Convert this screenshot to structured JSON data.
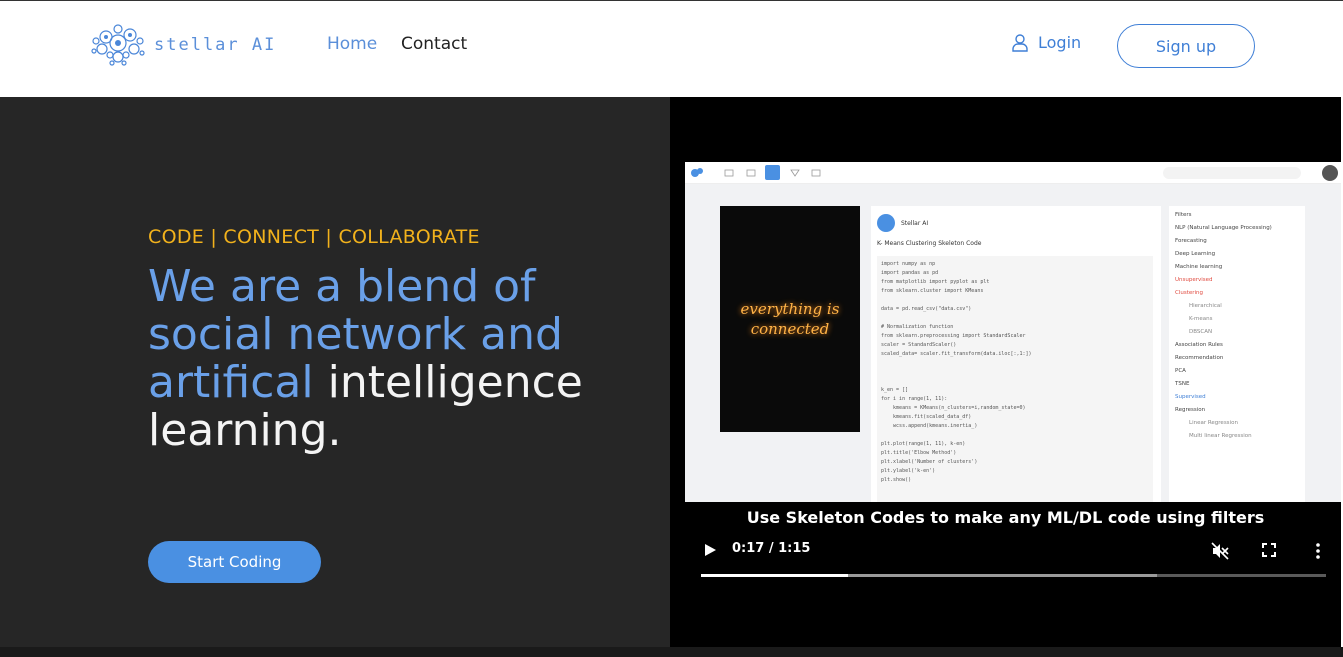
{
  "nav": {
    "brand": "stellar AI",
    "links": [
      "Home",
      "Contact"
    ],
    "login_label": "Login",
    "signup_label": "Sign up"
  },
  "hero": {
    "tagline": "CODE | CONNECT | COLLABORATE",
    "headline_blue": "We are a blend of social network and artifical",
    "headline_white": "intelligence learning.",
    "cta_label": "Start Coding"
  },
  "video": {
    "caption": "Use Skeleton Codes to make any ML/DL code using filters",
    "time": "0:17 / 1:15",
    "played_fraction": 0.235,
    "buffered_fraction": 0.73,
    "preview": {
      "neon_text": "everything is connected",
      "card_name": "Stellar AI",
      "card_title": "K- Means Clustering Skeleton Code",
      "code": "import numpy as np\nimport pandas as pd\nfrom matplotlib import pyplot as plt\nfrom sklearn.cluster import KMeans\n\ndata = pd.read_csv(\"data.csv\")\n\n# Normalization function\nfrom sklearn.preprocessing import StandardScaler\nscaler = StandardScaler()\nscaled_data= scaler.fit_transform(data.iloc[:,1:])\n\n\n\nk_en = []\nfor i in range(1, 11):\n    kmeans = KMeans(n_clusters=i,random_state=0)\n    kmeans.fit(scaled_data_df)\n    wcss.append(kmeans.inertia_)\n\nplt.plot(range(1, 11), k-en)\nplt.title('Elbow Method')\nplt.xlabel('Number of clusters')\nplt.ylabel('k-en')\nplt.show()",
      "filters_title": "Filters",
      "filters": [
        "NLP (Natural Language Processing)",
        "Forecasting",
        "Deep Learning",
        "Machine learning",
        "Unsupervised",
        "Clustering",
        "Hierarchical",
        "K-means",
        "DBSCAN",
        "Association Rules",
        "Recommendation",
        "PCA",
        "TSNE",
        "Supervised",
        "Regression",
        "Linear Regression",
        "Multi linear Regression"
      ]
    }
  },
  "colors": {
    "brand_blue": "#3f7fd6",
    "headline_blue": "#6aa0e8",
    "tagline_yellow": "#f2b21c",
    "hero_bg": "#262626"
  }
}
